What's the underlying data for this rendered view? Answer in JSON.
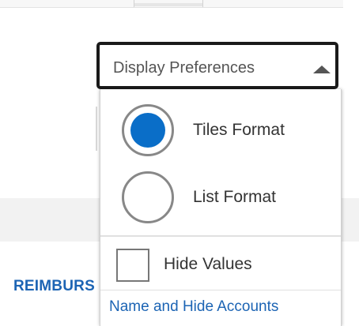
{
  "background": {
    "section_label": "REIMBURS"
  },
  "dropdown": {
    "button_label": "Display Preferences",
    "caret_icon": "caret-up-icon",
    "format_options": [
      {
        "label": "Tiles Format",
        "selected": true
      },
      {
        "label": "List Format",
        "selected": false
      }
    ],
    "hide_values": {
      "label": "Hide Values",
      "checked": false
    },
    "link_label": "Name and Hide Accounts"
  },
  "colors": {
    "accent": "#0a6ec8",
    "link": "#1c64b4",
    "button_border": "#1a1a1a"
  }
}
